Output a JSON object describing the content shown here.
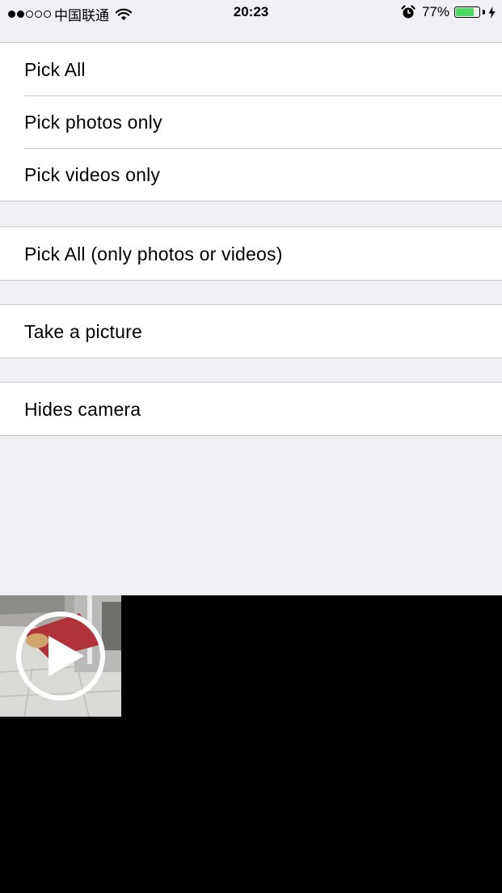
{
  "status_bar": {
    "carrier": "中国联通",
    "time": "20:23",
    "battery_percent": "77%",
    "battery_level": 0.77,
    "signal_bars_filled": 2,
    "signal_bars_total": 5
  },
  "groups": [
    {
      "items": [
        {
          "label": "Pick All"
        },
        {
          "label": "Pick photos only"
        },
        {
          "label": "Pick videos only"
        }
      ]
    },
    {
      "items": [
        {
          "label": "Pick All (only photos or videos)"
        }
      ]
    },
    {
      "items": [
        {
          "label": "Take a picture"
        }
      ]
    },
    {
      "items": [
        {
          "label": "Hides camera"
        }
      ]
    }
  ],
  "picker": {
    "thumbnail_type": "video",
    "icon": "play-icon"
  },
  "colors": {
    "background": "#efeff4",
    "battery": "#4cd964",
    "separator": "#c8c7cc",
    "picker_background": "#000000"
  }
}
